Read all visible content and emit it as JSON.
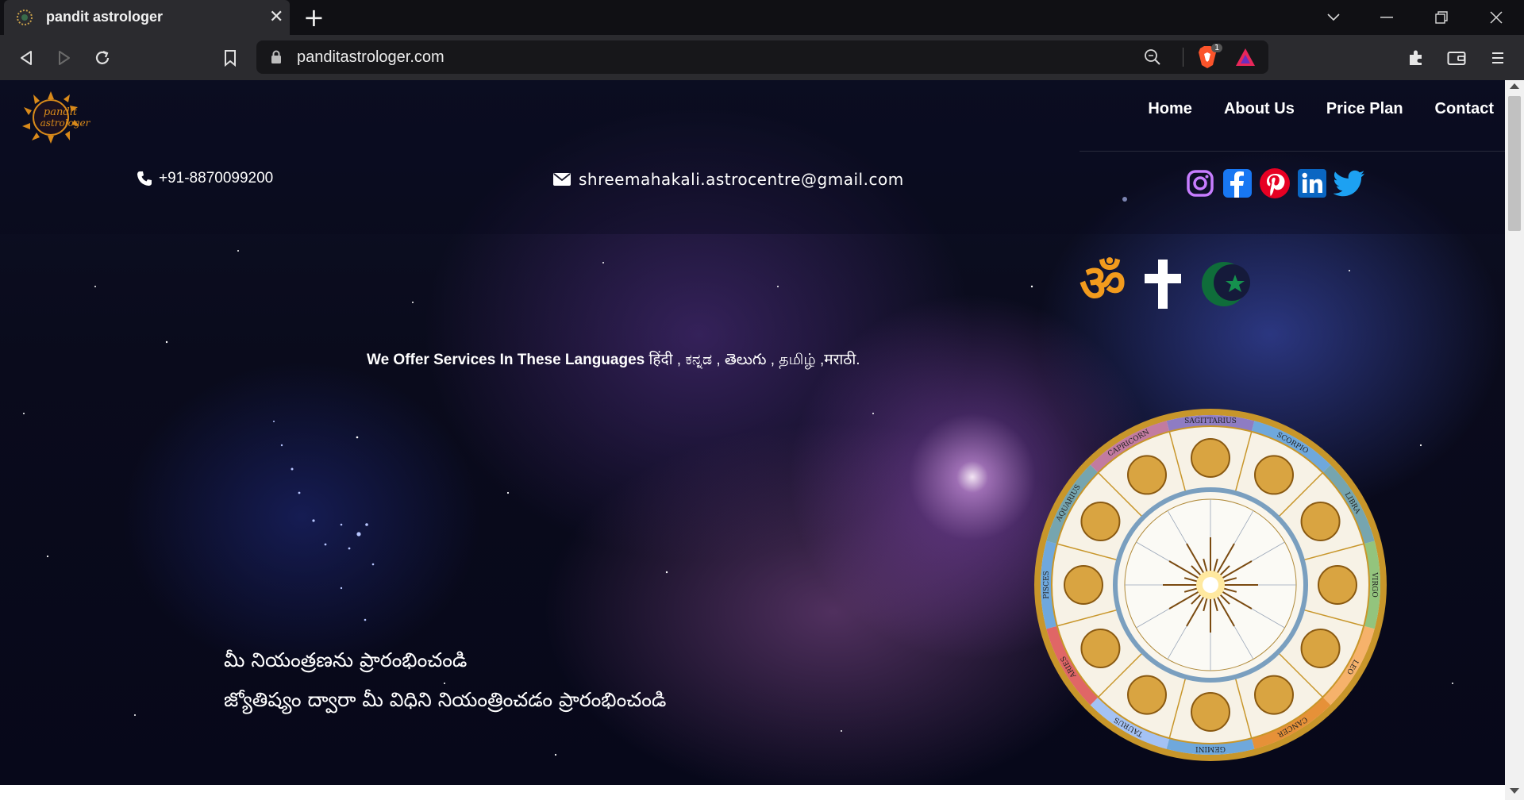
{
  "browser": {
    "tab_title": "pandit astrologer",
    "tab_close": "✕",
    "new_tab": "+",
    "url": "panditastrologer.com",
    "brave_shield_count": "1"
  },
  "site": {
    "logo_line1": "pandit",
    "logo_line2": "astrologer",
    "nav": [
      "Home",
      "About Us",
      "Price Plan",
      "Contact"
    ],
    "phone": "+91-8870099200",
    "email": "shreemahakali.astrocentre@gmail.com",
    "social": [
      "instagram-icon",
      "facebook-icon",
      "pinterest-icon",
      "linkedin-icon",
      "twitter-icon"
    ],
    "religion_symbols": [
      "om-icon",
      "cross-icon",
      "crescent-star-icon"
    ],
    "om_glyph": "ॐ",
    "languages_lead": "We Offer Services In These Languages",
    "languages_list": " हिंदी , ಕನ್ನಡ , తెలుగు , தமிழ் ,मराठी.",
    "telugu_line1": "మీ నియంత్రణను ప్రారంభించండి",
    "telugu_line2": "జ్యోతిష్యం ద్వారా మీ విధిని నియంత్రించడం ప్రారంభించండి",
    "zodiac_signs": [
      "SAGITTARIUS",
      "SCORPIO",
      "LIBRA",
      "VIRGO",
      "LEO",
      "CANCER",
      "GEMINI",
      "TAURUS",
      "ARIES",
      "PISCES",
      "AQUARIUS",
      "CAPRICORN"
    ]
  },
  "colors": {
    "accent_orange": "#f29b1d",
    "crescent_green": "#0f6d3a",
    "facebook": "#1877f2",
    "pinterest": "#e60023",
    "linkedin": "#0a66c2",
    "twitter": "#1da1f2"
  }
}
